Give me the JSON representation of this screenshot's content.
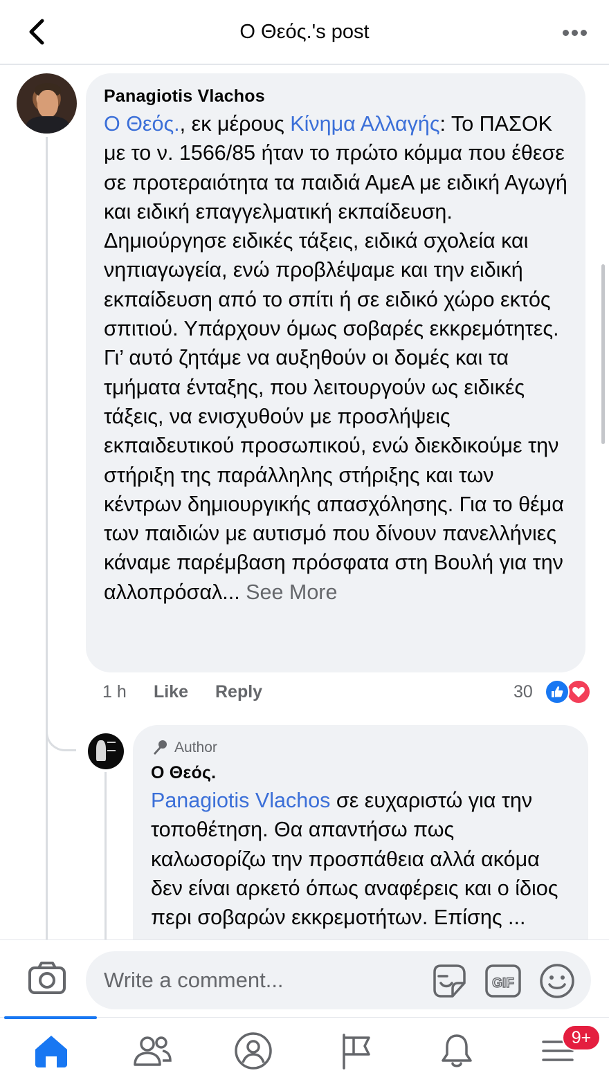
{
  "header": {
    "title": "Ο Θεός.'s post",
    "back_icon": "chevron-left-icon",
    "more_icon": "more-horizontal-icon"
  },
  "comment1": {
    "author": "Panagiotis Vlachos",
    "mention1": "Ο Θεός.",
    "connector": ", εκ μέρους ",
    "mention2": "Κίνημα Αλλαγής",
    "body": ": Το ΠΑΣΟΚ με το ν. 1566/85 ήταν το πρώτο κόμμα που έθεσε σε προτεραιότητα τα παιδιά ΑμεΑ με ειδική Αγωγή και ειδική επαγγελματική εκπαίδευση. Δημιούργησε ειδικές τάξεις, ειδικά σχολεία και νηπιαγωγεία, ενώ προβλέψαμε και την ειδική εκπαίδευση από το σπίτι ή σε ειδικό χώρο εκτός σπιτιού. Υπάρχουν όμως σοβαρές εκκρεμότητες. Γι’ αυτό  ζητάμε να αυξηθούν οι δομές και τα τμήματα ένταξης, που λειτουργούν ως ειδικές τάξεις, να ενισχυθούν με προσλήψεις εκπαιδευτικού προσωπικού, ενώ διεκδικούμε την στήριξη της παράλληλης στήριξης και των κέντρων δημιουργικής απασχόλησης. Για το θέμα των παιδιών με αυτισμό που δίνουν πανελλήνιες κάναμε παρέμβαση πρόσφατα στη Βουλή για την αλλοπρόσαλ... ",
    "see_more": "See More",
    "time": "1 h",
    "like_label": "Like",
    "reply_label": "Reply",
    "reaction_count": "30",
    "reactions": [
      "like-reaction-icon",
      "love-reaction-icon"
    ]
  },
  "comment2": {
    "badge": "Author",
    "badge_icon": "microphone-icon",
    "author": "Ο Θεός.",
    "mention": "Panagiotis Vlachos",
    "body": " σε ευχαριστώ για την τοποθέτηση. Θα απαντήσω πως καλωσορίζω την προσπάθεια αλλά ακόμα δεν είναι αρκετό όπως αναφέρεις και ο ίδιος περι σοβαρών εκκρεμοτήτων. Επίσης ..."
  },
  "composer": {
    "placeholder": "Write a comment...",
    "camera_icon": "camera-icon",
    "sticker_icon": "sticker-icon",
    "gif_icon": "gif-icon",
    "emoji_icon": "emoji-icon"
  },
  "tabbar": {
    "tabs": [
      "home-icon",
      "friends-icon",
      "profile-icon",
      "pages-flag-icon",
      "notifications-bell-icon",
      "menu-icon"
    ],
    "menu_badge": "9+"
  },
  "colors": {
    "accent": "#1877f2",
    "mention": "#3b6fd8",
    "bubble": "#f0f2f5",
    "secondary_text": "#65676b",
    "badge": "#e41e3f",
    "love": "#f33e58"
  }
}
